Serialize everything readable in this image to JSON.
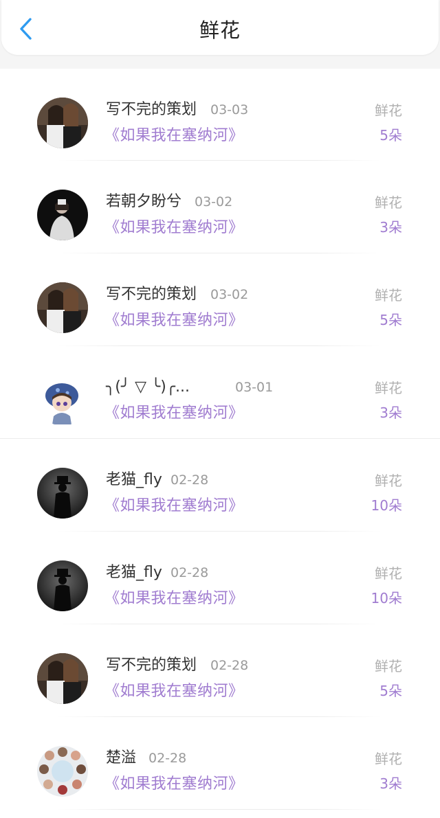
{
  "header": {
    "title": "鲜花",
    "back_icon": "chevron-left-icon",
    "accent_color": "#2e9bf0"
  },
  "colors": {
    "book_title": "#a07cd0",
    "count": "#a07cd0",
    "date": "#9a9a9a",
    "gift_label": "#b0b0b0"
  },
  "records": [
    {
      "user": "写不完的策划",
      "date": "03-03",
      "book": "《如果我在塞纳河》",
      "gift_label": "鲜花",
      "count": "5朵",
      "avatar": "avatar-two-girls-icon"
    },
    {
      "user": "若朝夕盼兮",
      "date": "03-02",
      "book": "《如果我在塞纳河》",
      "gift_label": "鲜花",
      "count": "3朵",
      "avatar": "avatar-girl-dark-icon"
    },
    {
      "user": "写不完的策划",
      "date": "03-02",
      "book": "《如果我在塞纳河》",
      "gift_label": "鲜花",
      "count": "5朵",
      "avatar": "avatar-two-girls-icon"
    },
    {
      "user": "╮(╯ ▽ ╰)╭...",
      "date": "03-01",
      "book": "《如果我在塞纳河》",
      "gift_label": "鲜花",
      "count": "3朵",
      "avatar": "avatar-cartoon-boy-icon"
    },
    {
      "user": "老猫_fly",
      "date": "02-28",
      "book": "《如果我在塞纳河》",
      "gift_label": "鲜花",
      "count": "10朵",
      "avatar": "avatar-silhouette-hat-icon"
    },
    {
      "user": "老猫_fly",
      "date": "02-28",
      "book": "《如果我在塞纳河》",
      "gift_label": "鲜花",
      "count": "10朵",
      "avatar": "avatar-silhouette-hat-icon"
    },
    {
      "user": "写不完的策划",
      "date": "02-28",
      "book": "《如果我在塞纳河》",
      "gift_label": "鲜花",
      "count": "5朵",
      "avatar": "avatar-two-girls-icon"
    },
    {
      "user": "楚溢",
      "date": "02-28",
      "book": "《如果我在塞纳河》",
      "gift_label": "鲜花",
      "count": "3朵",
      "avatar": "avatar-group-circle-icon"
    }
  ]
}
